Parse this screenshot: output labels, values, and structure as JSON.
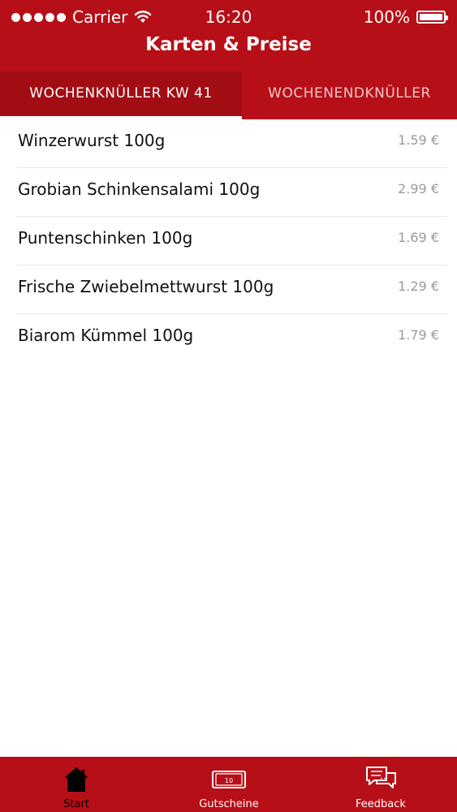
{
  "status_bar": {
    "carrier": "Carrier",
    "time": "16:20",
    "battery": "100%"
  },
  "nav": {
    "title": "Karten & Preise"
  },
  "tabs": [
    {
      "label": "WOCHENKNÜLLER KW 41",
      "active": true
    },
    {
      "label": "WOCHENENDKNÜLLER",
      "active": false
    }
  ],
  "items": [
    {
      "name": "Winzerwurst 100g",
      "price": "1.59 €"
    },
    {
      "name": "Grobian Schinkensalami 100g",
      "price": "2.99 €"
    },
    {
      "name": "Puntenschinken 100g",
      "price": "1.69 €"
    },
    {
      "name": "Frische Zwiebelmettwurst 100g",
      "price": "1.29 €"
    },
    {
      "name": "Biarom Kümmel 100g",
      "price": "1.79 €"
    }
  ],
  "tabbar": {
    "start": "Start",
    "gutscheine": "Gutscheine",
    "gutschein_value": "10",
    "feedback": "Feedback"
  },
  "colors": {
    "brand_red": "#b70f18",
    "tab_active_bg": "#a20d14",
    "price_gray": "#9a9a9a"
  }
}
